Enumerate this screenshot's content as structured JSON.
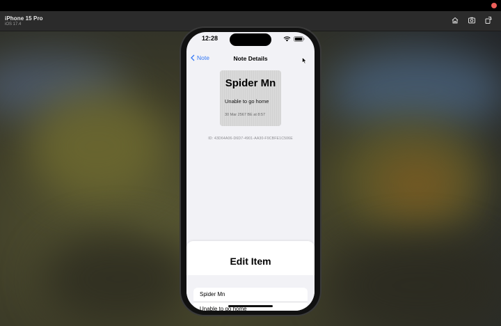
{
  "simulator": {
    "device_name": "iPhone 15 Pro",
    "os_version": "iOS 17.4",
    "toolbar_icons": [
      "home-icon",
      "screenshot-icon",
      "rotate-icon"
    ]
  },
  "status_bar": {
    "time": "12:28",
    "icons": [
      "wifi-icon",
      "battery-icon"
    ]
  },
  "nav": {
    "back_label": "Note",
    "title": "Note Details"
  },
  "note": {
    "title": "Spider Mn",
    "body": "Unable to go home",
    "date": "30 Mar 2567 BE at 8:57",
    "id_text": "ID: 43D64A06-D6D7-4901-AA30-F9CBFE1C506E"
  },
  "sheet": {
    "title": "Edit Item",
    "fields": [
      {
        "value": "Spider Mn"
      },
      {
        "value": "Unable to go home"
      }
    ]
  },
  "colors": {
    "accent": "#3478f6",
    "screen_bg": "#f2f2f6",
    "card_bg": "#d9d9d9",
    "sim_bar": "#2b2b2b"
  }
}
